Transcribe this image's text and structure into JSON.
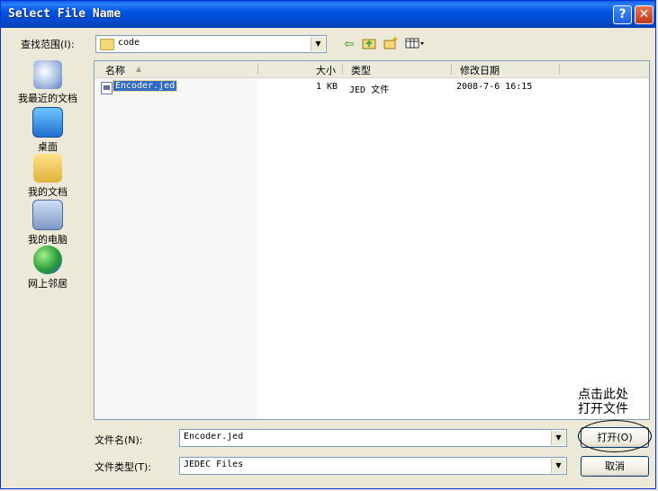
{
  "title": "Select File Name",
  "title_buttons": {
    "help": "?",
    "close": "✕"
  },
  "look_in": {
    "label": "查找范围(I):",
    "value": "code"
  },
  "places": [
    {
      "label": "我最近的文档",
      "icon": "recent-documents-icon"
    },
    {
      "label": "桌面",
      "icon": "desktop-icon"
    },
    {
      "label": "我的文档",
      "icon": "my-documents-icon"
    },
    {
      "label": "我的电脑",
      "icon": "my-computer-icon"
    },
    {
      "label": "网上邻居",
      "icon": "network-places-icon"
    }
  ],
  "columns": {
    "name": "名称",
    "size": "大小",
    "type": "类型",
    "modified": "修改日期"
  },
  "files": [
    {
      "name": "Encoder.jed",
      "size": "1 KB",
      "type": "JED 文件",
      "modified": "2008-7-6 16:15",
      "selected": true
    }
  ],
  "filename": {
    "label": "文件名(N):",
    "value": "Encoder.jed"
  },
  "filetype": {
    "label": "文件类型(T):",
    "value": "JEDEC Files"
  },
  "buttons": {
    "open": "打开(O)",
    "cancel": "取消"
  },
  "annotation": {
    "line1": "点击此处",
    "line2": "打开文件"
  },
  "colors": {
    "title_bar": "#0054e3",
    "selection": "#316ac5",
    "close_button": "#c4371a"
  }
}
